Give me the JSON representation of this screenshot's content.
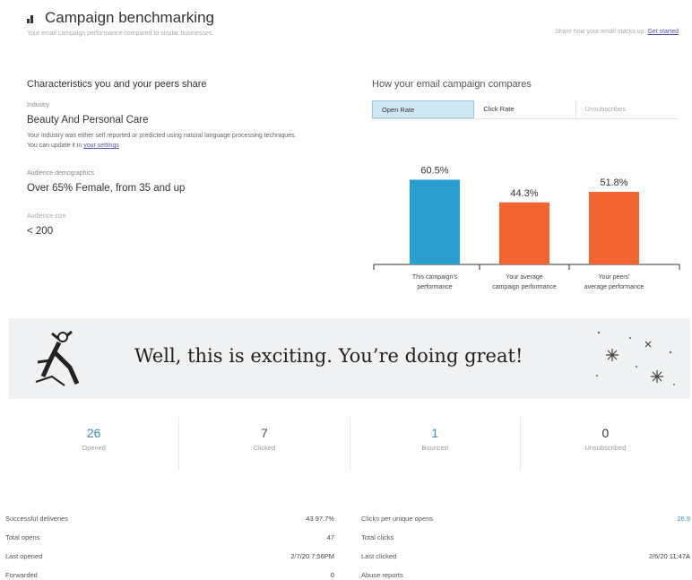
{
  "header": {
    "title": "Campaign benchmarking",
    "subtitle": "Your email campaign performance compared to similar businesses.",
    "share_text": "Share how your email stacks up.",
    "share_link": "Get started"
  },
  "characteristics": {
    "title": "Characteristics you and your peers share",
    "industry_label": "Industry",
    "industry_value": "Beauty And Personal Care",
    "industry_note": "Your industry was either self reported or predicted using natural language processing techniques. You can update it in",
    "industry_note_link": "your settings",
    "audience_demo_label": "Audience demographics",
    "audience_demo_value": "Over 65% Female, from 35 and up",
    "audience_size_label": "Audience size",
    "audience_size_value": "< 200"
  },
  "comparison": {
    "title": "How your email campaign compares",
    "tabs": [
      "Open Rate",
      "Click Rate",
      "Unsubscribes"
    ]
  },
  "chart_data": {
    "type": "bar",
    "categories": [
      "This campaign's performance",
      "Your average campaign performance",
      "Your peers' average performance"
    ],
    "values": [
      60.5,
      44.3,
      51.8
    ],
    "value_labels": [
      "60.5%",
      "44.3%",
      "51.8%"
    ],
    "colors": [
      "#2a9fcf",
      "#f26533",
      "#f26533"
    ],
    "ylim": [
      0,
      80
    ]
  },
  "banner": {
    "text": "Well, this is exciting. You’re doing great!"
  },
  "stats": [
    {
      "value": "26",
      "label": "Opened",
      "color": "#3a8fc2"
    },
    {
      "value": "7",
      "label": "Clicked",
      "color": "#555555"
    },
    {
      "value": "1",
      "label": "Bounced",
      "color": "#3a8fc2"
    },
    {
      "value": "0",
      "label": "Unsubscribed",
      "color": "#333333"
    }
  ],
  "details_left": [
    {
      "label": "Successful deliveries",
      "value": "43  97.7%"
    },
    {
      "label": "Total opens",
      "value": "47"
    },
    {
      "label": "Last opened",
      "value": "2/7/20 7:56PM"
    },
    {
      "label": "Forwarded",
      "value": "0"
    }
  ],
  "details_right": [
    {
      "label": "Clicks per unique opens",
      "value": "26.9"
    },
    {
      "label": "Total clicks",
      "value": ""
    },
    {
      "label": "Last clicked",
      "value": "2/6/20 11:47A"
    },
    {
      "label": "Abuse reports",
      "value": ""
    }
  ]
}
